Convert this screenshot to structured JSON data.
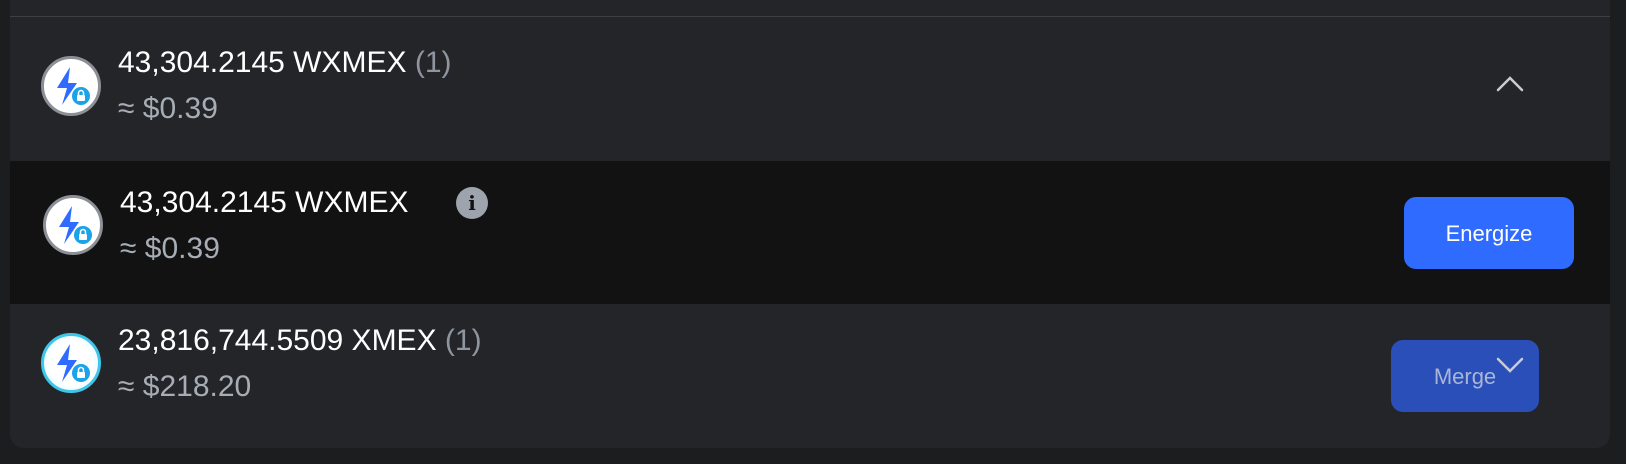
{
  "tokens": {
    "wxmex_group": {
      "amount": "43,304.2145 WXMEX",
      "count": "(1)",
      "usd": "≈ $0.39",
      "icon": "energy-lock-icon"
    },
    "wxmex_item": {
      "amount": "43,304.2145 WXMEX",
      "usd": "≈ $0.39",
      "info_glyph": "i",
      "action_label": "Energize",
      "icon": "energy-lock-icon"
    },
    "xmex_group": {
      "amount": "23,816,744.5509 XMEX",
      "count": "(1)",
      "usd": "≈ $218.20",
      "action_label": "Merge",
      "icon": "energy-lock-icon"
    }
  },
  "colors": {
    "accent": "#2f6bff",
    "accent_muted": "#2a4fb8",
    "background": "#242528",
    "expanded_background": "#121212"
  }
}
